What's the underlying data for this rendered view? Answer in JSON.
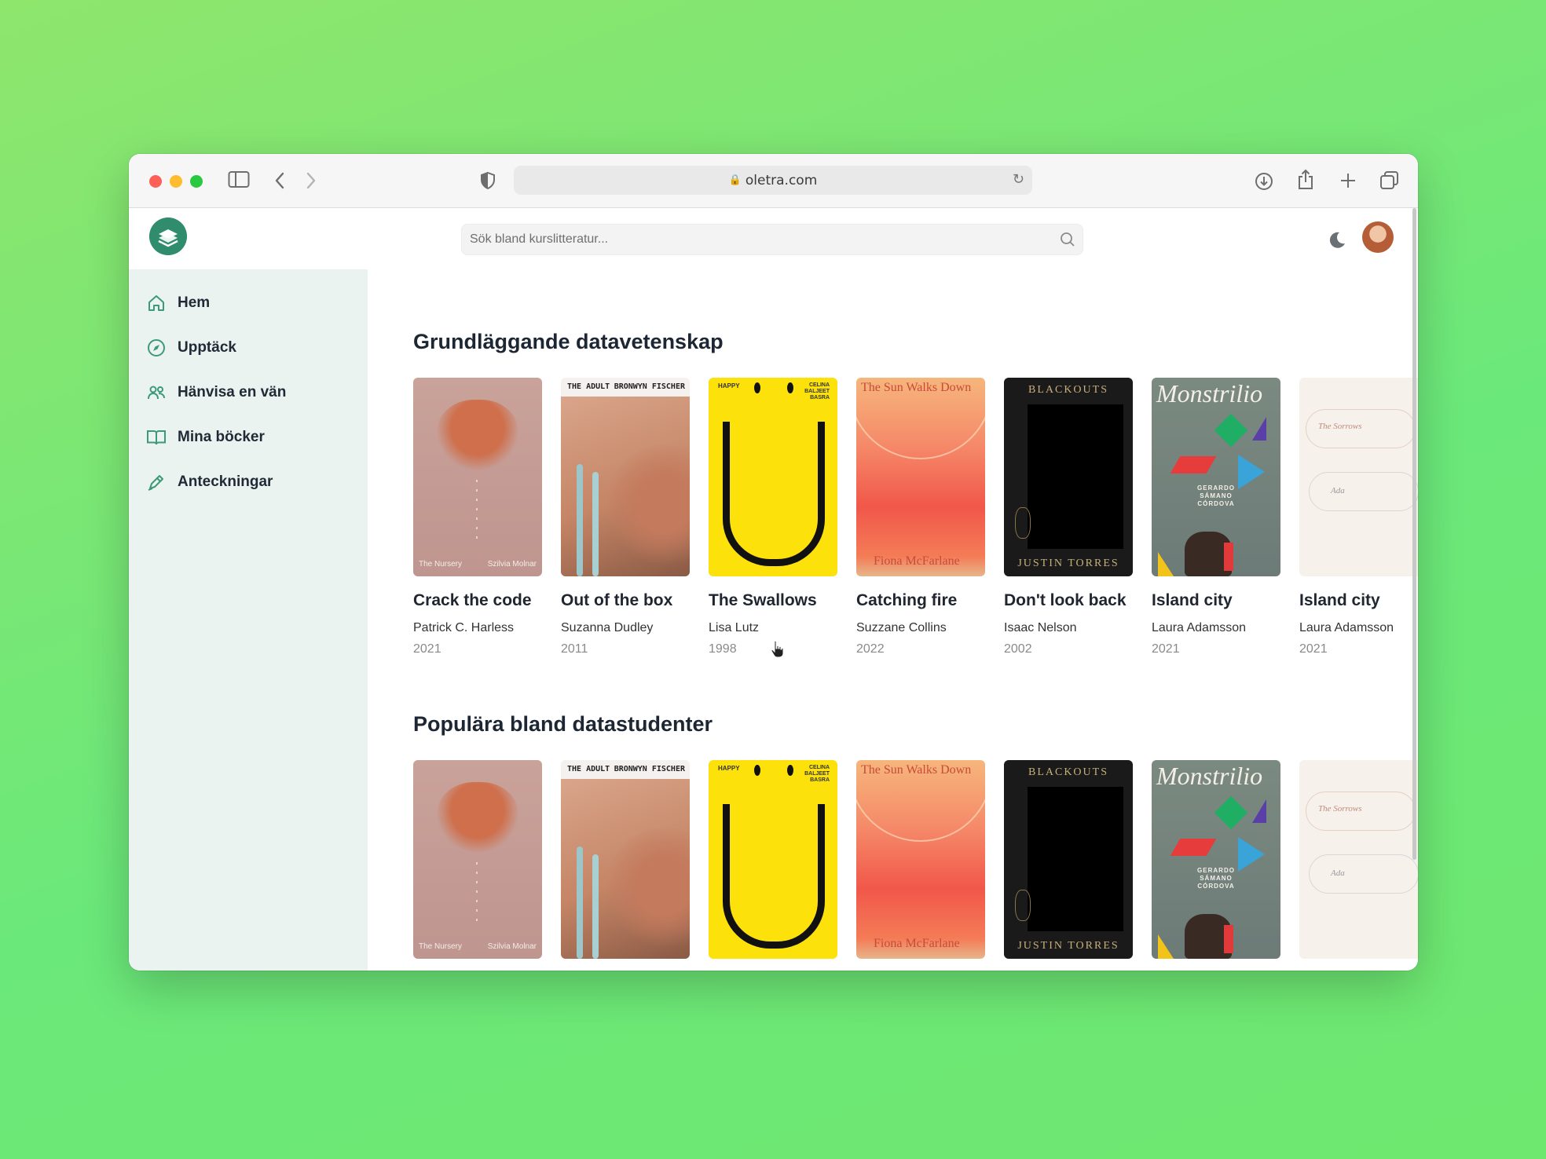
{
  "browser": {
    "url": "oletra.com"
  },
  "app": {
    "search_placeholder": "Sök bland kurslitteratur..."
  },
  "sidebar": {
    "items": [
      {
        "label": "Hem",
        "icon": "home-icon"
      },
      {
        "label": "Upptäck",
        "icon": "compass-icon"
      },
      {
        "label": "Hänvisa en vän",
        "icon": "users-icon"
      },
      {
        "label": "Mina böcker",
        "icon": "open-book-icon"
      },
      {
        "label": "Anteckningar",
        "icon": "pen-icon"
      }
    ]
  },
  "sections": [
    {
      "title": "Grundläggande datavetenskap",
      "books": [
        {
          "title": "Crack the code",
          "author": "Patrick C. Harless",
          "year": "2021",
          "cover_text": [
            "The Nursery",
            "Szilvia Molnar"
          ]
        },
        {
          "title": "Out of the box",
          "author": "Suzanna Dudley",
          "year": "2011",
          "cover_text": [
            "THE ADULT",
            "BRONWYN FISCHER"
          ]
        },
        {
          "title": "The Swallows",
          "author": "Lisa Lutz",
          "year": "1998",
          "cover_text": [
            "HAPPY",
            "CELINA BALJEET BASRA"
          ]
        },
        {
          "title": "Catching fire",
          "author": "Suzzane Collins",
          "year": "2022",
          "cover_text": [
            "The Sun Walks Down",
            "Fiona McFarlane"
          ]
        },
        {
          "title": "Don't look back",
          "author": "Isaac Nelson",
          "year": "2002",
          "cover_text": [
            "BLACKOUTS",
            "JUSTIN TORRES"
          ]
        },
        {
          "title": "Island city",
          "author": "Laura Adamsson",
          "year": "2021",
          "cover_text": [
            "Monstrilio",
            "GERARDO SÁMANO CÓRDOVA"
          ]
        },
        {
          "title": "Island city",
          "author": "Laura Adamsson",
          "year": "2021",
          "cover_text": [
            "The Sorrows",
            "Ada"
          ]
        }
      ]
    },
    {
      "title": "Populära bland datastudenter",
      "books": [
        {
          "cover_text": [
            "The Nursery",
            "Szilvia Molnar"
          ]
        },
        {
          "cover_text": [
            "THE ADULT",
            "BRONWYN FISCHER"
          ]
        },
        {
          "cover_text": [
            "HAPPY",
            "CELINA BALJEET BASRA"
          ]
        },
        {
          "cover_text": [
            "The Sun Walks Down",
            "Fiona McFarlane"
          ]
        },
        {
          "cover_text": [
            "BLACKOUTS",
            "JUSTIN TORRES"
          ]
        },
        {
          "cover_text": [
            "Monstrilio",
            "GERARDO SÁMANO CÓRDOVA"
          ]
        },
        {
          "cover_text": [
            "The Sorrows",
            "Ada"
          ]
        }
      ]
    }
  ],
  "colors": {
    "brand": "#2f8d6e",
    "sidebar_bg": "#ebf3f0",
    "page_bg": "#7ae86f"
  }
}
